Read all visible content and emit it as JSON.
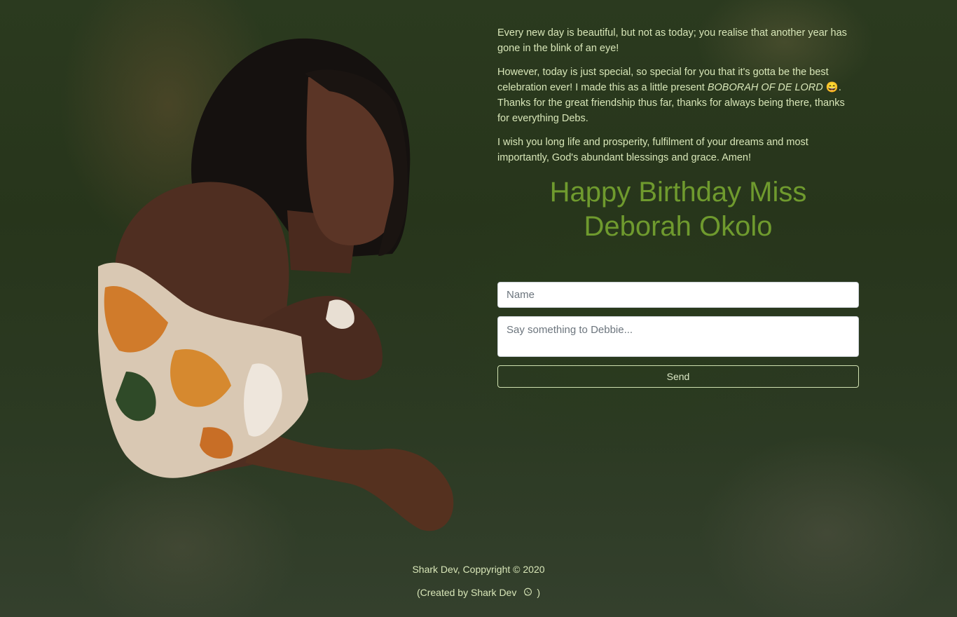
{
  "message": {
    "paragraph1": "Every new day is beautiful, but not as today; you realise that another year has gone in the blink of an eye!",
    "paragraph2_before": "However, today is just special, so special for you that it's gotta be the best celebration ever! I made this as a little present ",
    "paragraph2_emphasis": "BOBORAH OF DE LORD",
    "paragraph2_emoji": "😄",
    "paragraph2_after": ". Thanks for the great friendship thus far, thanks for always being there, thanks for everything Debs.",
    "paragraph3": "I wish you long life and prosperity, fulfilment of your dreams and most importantly, God's abundant blessings and grace. Amen!"
  },
  "title": {
    "line1": "Happy Birthday Miss",
    "line2": "Deborah Okolo"
  },
  "form": {
    "name_placeholder": "Name",
    "message_placeholder": "Say something to Debbie...",
    "send_label": "Send"
  },
  "footer": {
    "copyright": "Shark Dev, Coppyright © 2020",
    "created_by_prefix": "(Created by Shark Dev",
    "created_by_suffix": ")",
    "icon": "whatsapp-icon"
  },
  "colors": {
    "text": "#d8e6b8",
    "title": "#6f9a2e",
    "background": "#2b3a1f"
  }
}
